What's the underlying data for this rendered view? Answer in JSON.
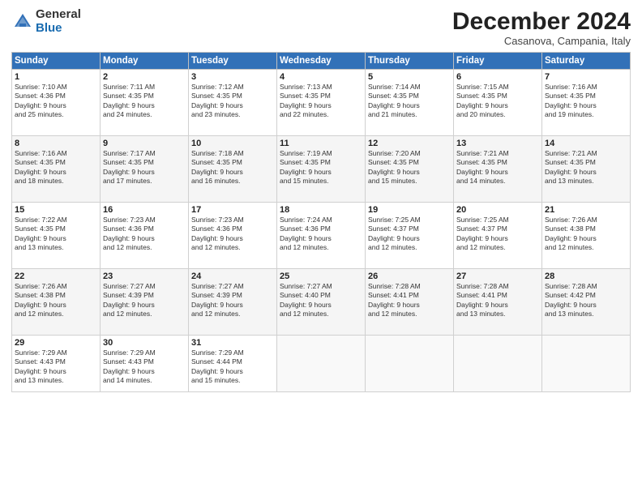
{
  "logo": {
    "general": "General",
    "blue": "Blue"
  },
  "title": "December 2024",
  "subtitle": "Casanova, Campania, Italy",
  "days_header": [
    "Sunday",
    "Monday",
    "Tuesday",
    "Wednesday",
    "Thursday",
    "Friday",
    "Saturday"
  ],
  "weeks": [
    [
      {
        "num": "1",
        "info": "Sunrise: 7:10 AM\nSunset: 4:36 PM\nDaylight: 9 hours\nand 25 minutes."
      },
      {
        "num": "2",
        "info": "Sunrise: 7:11 AM\nSunset: 4:35 PM\nDaylight: 9 hours\nand 24 minutes."
      },
      {
        "num": "3",
        "info": "Sunrise: 7:12 AM\nSunset: 4:35 PM\nDaylight: 9 hours\nand 23 minutes."
      },
      {
        "num": "4",
        "info": "Sunrise: 7:13 AM\nSunset: 4:35 PM\nDaylight: 9 hours\nand 22 minutes."
      },
      {
        "num": "5",
        "info": "Sunrise: 7:14 AM\nSunset: 4:35 PM\nDaylight: 9 hours\nand 21 minutes."
      },
      {
        "num": "6",
        "info": "Sunrise: 7:15 AM\nSunset: 4:35 PM\nDaylight: 9 hours\nand 20 minutes."
      },
      {
        "num": "7",
        "info": "Sunrise: 7:16 AM\nSunset: 4:35 PM\nDaylight: 9 hours\nand 19 minutes."
      }
    ],
    [
      {
        "num": "8",
        "info": "Sunrise: 7:16 AM\nSunset: 4:35 PM\nDaylight: 9 hours\nand 18 minutes."
      },
      {
        "num": "9",
        "info": "Sunrise: 7:17 AM\nSunset: 4:35 PM\nDaylight: 9 hours\nand 17 minutes."
      },
      {
        "num": "10",
        "info": "Sunrise: 7:18 AM\nSunset: 4:35 PM\nDaylight: 9 hours\nand 16 minutes."
      },
      {
        "num": "11",
        "info": "Sunrise: 7:19 AM\nSunset: 4:35 PM\nDaylight: 9 hours\nand 15 minutes."
      },
      {
        "num": "12",
        "info": "Sunrise: 7:20 AM\nSunset: 4:35 PM\nDaylight: 9 hours\nand 15 minutes."
      },
      {
        "num": "13",
        "info": "Sunrise: 7:21 AM\nSunset: 4:35 PM\nDaylight: 9 hours\nand 14 minutes."
      },
      {
        "num": "14",
        "info": "Sunrise: 7:21 AM\nSunset: 4:35 PM\nDaylight: 9 hours\nand 13 minutes."
      }
    ],
    [
      {
        "num": "15",
        "info": "Sunrise: 7:22 AM\nSunset: 4:35 PM\nDaylight: 9 hours\nand 13 minutes."
      },
      {
        "num": "16",
        "info": "Sunrise: 7:23 AM\nSunset: 4:36 PM\nDaylight: 9 hours\nand 12 minutes."
      },
      {
        "num": "17",
        "info": "Sunrise: 7:23 AM\nSunset: 4:36 PM\nDaylight: 9 hours\nand 12 minutes."
      },
      {
        "num": "18",
        "info": "Sunrise: 7:24 AM\nSunset: 4:36 PM\nDaylight: 9 hours\nand 12 minutes."
      },
      {
        "num": "19",
        "info": "Sunrise: 7:25 AM\nSunset: 4:37 PM\nDaylight: 9 hours\nand 12 minutes."
      },
      {
        "num": "20",
        "info": "Sunrise: 7:25 AM\nSunset: 4:37 PM\nDaylight: 9 hours\nand 12 minutes."
      },
      {
        "num": "21",
        "info": "Sunrise: 7:26 AM\nSunset: 4:38 PM\nDaylight: 9 hours\nand 12 minutes."
      }
    ],
    [
      {
        "num": "22",
        "info": "Sunrise: 7:26 AM\nSunset: 4:38 PM\nDaylight: 9 hours\nand 12 minutes."
      },
      {
        "num": "23",
        "info": "Sunrise: 7:27 AM\nSunset: 4:39 PM\nDaylight: 9 hours\nand 12 minutes."
      },
      {
        "num": "24",
        "info": "Sunrise: 7:27 AM\nSunset: 4:39 PM\nDaylight: 9 hours\nand 12 minutes."
      },
      {
        "num": "25",
        "info": "Sunrise: 7:27 AM\nSunset: 4:40 PM\nDaylight: 9 hours\nand 12 minutes."
      },
      {
        "num": "26",
        "info": "Sunrise: 7:28 AM\nSunset: 4:41 PM\nDaylight: 9 hours\nand 12 minutes."
      },
      {
        "num": "27",
        "info": "Sunrise: 7:28 AM\nSunset: 4:41 PM\nDaylight: 9 hours\nand 13 minutes."
      },
      {
        "num": "28",
        "info": "Sunrise: 7:28 AM\nSunset: 4:42 PM\nDaylight: 9 hours\nand 13 minutes."
      }
    ],
    [
      {
        "num": "29",
        "info": "Sunrise: 7:29 AM\nSunset: 4:43 PM\nDaylight: 9 hours\nand 13 minutes."
      },
      {
        "num": "30",
        "info": "Sunrise: 7:29 AM\nSunset: 4:43 PM\nDaylight: 9 hours\nand 14 minutes."
      },
      {
        "num": "31",
        "info": "Sunrise: 7:29 AM\nSunset: 4:44 PM\nDaylight: 9 hours\nand 15 minutes."
      },
      null,
      null,
      null,
      null
    ]
  ]
}
